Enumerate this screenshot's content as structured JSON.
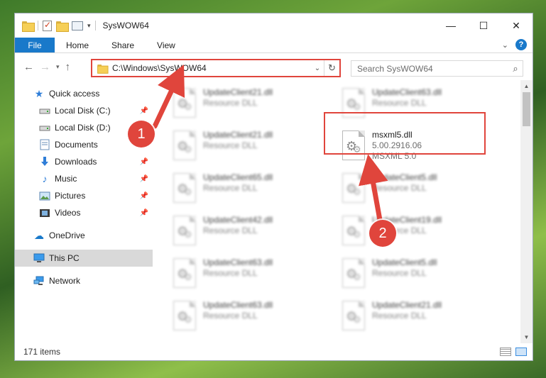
{
  "window": {
    "title": "SysWOW64",
    "controls": {
      "minimize": "—",
      "maximize": "☐",
      "close": "✕"
    }
  },
  "ribbon": {
    "tabs": [
      "File",
      "Home",
      "Share",
      "View"
    ],
    "help": "?"
  },
  "nav": {
    "back": "←",
    "forward": "→",
    "recent": "▾",
    "up": "↑"
  },
  "address": {
    "path": "C:\\Windows\\SysWOW64",
    "dropdown": "⌄",
    "refresh": "↻"
  },
  "search": {
    "placeholder": "Search SysWOW64",
    "icon": "⌕"
  },
  "sidebar": {
    "quick_access": "Quick access",
    "items": [
      {
        "label": "Local Disk (C:)",
        "icon": "drive-icon",
        "pinned": true
      },
      {
        "label": "Local Disk (D:)",
        "icon": "drive-icon",
        "pinned": false
      },
      {
        "label": "Documents",
        "icon": "documents-icon",
        "pinned": true
      },
      {
        "label": "Downloads",
        "icon": "downloads-icon",
        "pinned": true
      },
      {
        "label": "Music",
        "icon": "music-icon",
        "pinned": true
      },
      {
        "label": "Pictures",
        "icon": "pictures-icon",
        "pinned": true
      },
      {
        "label": "Videos",
        "icon": "videos-icon",
        "pinned": true
      }
    ],
    "onedrive": "OneDrive",
    "this_pc": "This PC",
    "network": "Network"
  },
  "files": [
    {
      "name": "UpdateClient21.dll",
      "line2": "Resource DLL",
      "col": 0,
      "row": 0
    },
    {
      "name": "UpdateClient63.dll",
      "line2": "Resource DLL",
      "col": 1,
      "row": 0
    },
    {
      "name": "UpdateClient21.dll",
      "line2": "Resource DLL",
      "col": 0,
      "row": 1
    },
    {
      "name": "UpdateClient65.dll",
      "line2": "Resource DLL",
      "col": 0,
      "row": 2
    },
    {
      "name": "UpdateClient5.dll",
      "line2": "Resource DLL",
      "col": 1,
      "row": 2
    },
    {
      "name": "UpdateClient42.dll",
      "line2": "Resource DLL",
      "col": 0,
      "row": 3
    },
    {
      "name": "UpdateClient19.dll",
      "line2": "Resource DLL",
      "col": 1,
      "row": 3
    },
    {
      "name": "UpdateClient63.dll",
      "line2": "Resource DLL",
      "col": 0,
      "row": 4
    },
    {
      "name": "UpdateClient5.dll",
      "line2": "Resource DLL",
      "col": 1,
      "row": 4
    },
    {
      "name": "UpdateClient63.dll",
      "line2": "Resource DLL",
      "col": 0,
      "row": 5
    },
    {
      "name": "UpdateClient21.dll",
      "line2": "Resource DLL",
      "col": 1,
      "row": 5
    }
  ],
  "highlighted_file": {
    "name": "msxml5.dll",
    "version": "5.00.2916.06",
    "description": "MSXML 5.0"
  },
  "status": {
    "count": "171 items"
  },
  "annotations": {
    "step1": "1",
    "step2": "2",
    "color": "#e0453c"
  }
}
